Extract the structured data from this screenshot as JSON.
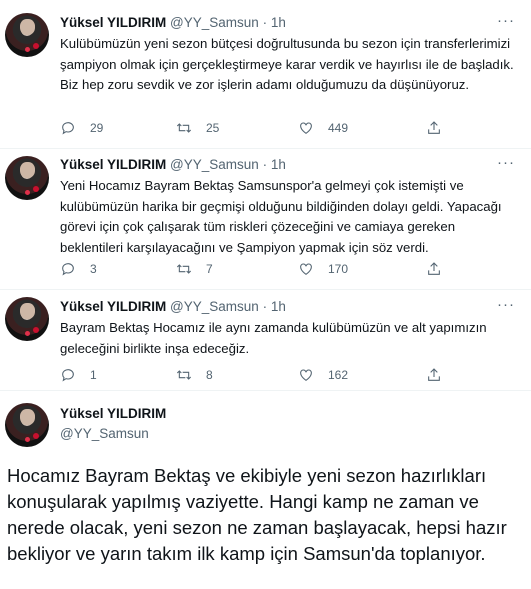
{
  "tweets": [
    {
      "name": "Yüksel YILDIRIM",
      "handle": "@YY_Samsun",
      "separator": "·",
      "time": "1h",
      "more": "···",
      "text": "Kulübümüzün yeni sezon bütçesi doğrultusunda bu sezon için transferlerimizi şampiyon olmak için gerçekleştirmeye karar verdik ve hayırlısı ile de başladık. Biz hep zoru sevdik ve zor işlerin adamı olduğumuzu da düşünüyoruz.",
      "replies": "29",
      "retweets": "25",
      "likes": "449"
    },
    {
      "name": "Yüksel YILDIRIM",
      "handle": "@YY_Samsun",
      "separator": "·",
      "time": "1h",
      "more": "···",
      "text": "Yeni Hocamız Bayram Bektaş Samsunspor'a gelmeyi çok istemişti ve kulübümüzün harika bir geçmişi olduğunu bildiğinden dolayı geldi. Yapacağı görevi için çok çalışarak tüm riskleri çözeceğini ve camiaya gereken beklentileri karşılayacağını ve Şampiyon yapmak için söz verdi.",
      "replies": "3",
      "retweets": "7",
      "likes": "170"
    },
    {
      "name": "Yüksel YILDIRIM",
      "handle": "@YY_Samsun",
      "separator": "·",
      "time": "1h",
      "more": "···",
      "text": "Bayram Bektaş Hocamız ile aynı zamanda kulübümüzün ve alt yapımızın geleceğini birlikte inşa edeceğiz.",
      "replies": "1",
      "retweets": "8",
      "likes": "162"
    }
  ],
  "main_tweet": {
    "name": "Yüksel YILDIRIM",
    "handle": "@YY_Samsun",
    "text": "Hocamız Bayram Bektaş ve ekibiyle yeni sezon hazırlıkları konuşularak yapılmış vaziyette. Hangi kamp ne zaman ve nerede olacak, yeni sezon ne zaman başlayacak, hepsi hazır bekliyor ve yarın takım ilk kamp için Samsun'da toplanıyor."
  },
  "icons": {
    "reply": "reply-icon",
    "retweet": "retweet-icon",
    "like": "heart-icon",
    "share": "share-icon",
    "more": "more-icon"
  }
}
